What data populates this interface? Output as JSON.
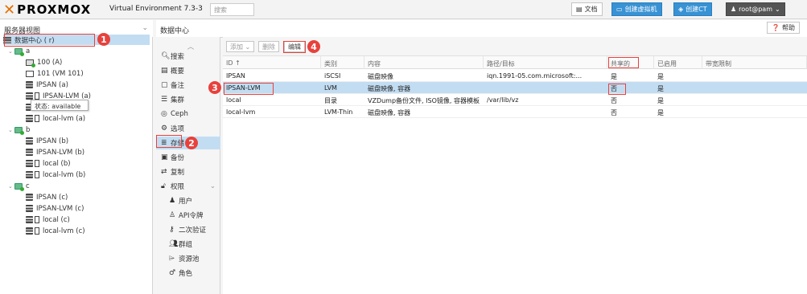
{
  "header": {
    "logo_x": "✕",
    "logo_text": "PROXMOX",
    "subtitle": "Virtual Environment 7.3-3",
    "search_placeholder": "搜索",
    "docs": "文档",
    "create_vm": "创建虚拟机",
    "create_ct": "创建CT",
    "user": "root@pam"
  },
  "left_panel": {
    "header": "服务器视图",
    "root": "数据中心 (               r)",
    "tooltip": "状态: available",
    "nodes": [
      {
        "name": "a",
        "children": [
          "100 (A)",
          "101 (VM 101)",
          "IPSAN (a)",
          "IPSAN-LVM (a)",
          "l",
          "local-lvm (a)"
        ]
      },
      {
        "name": "b",
        "children": [
          "IPSAN (b)",
          "IPSAN-LVM (b)",
          "local (b)",
          "local-lvm (b)"
        ]
      },
      {
        "name": "c",
        "children": [
          "IPSAN (c)",
          "IPSAN-LVM (c)",
          "local (c)",
          "local-lvm (c)"
        ]
      }
    ]
  },
  "content_header": {
    "title": "数据中心",
    "help": "帮助"
  },
  "nav": [
    {
      "label": "搜索",
      "icon": "search-icon"
    },
    {
      "label": "概要",
      "icon": "book-icon"
    },
    {
      "label": "备注",
      "icon": "note-icon"
    },
    {
      "label": "集群",
      "icon": "server-icon"
    },
    {
      "label": "Ceph",
      "icon": "ceph-icon"
    },
    {
      "label": "选项",
      "icon": "gear-icon"
    },
    {
      "label": "存储",
      "icon": "database-icon"
    },
    {
      "label": "备份",
      "icon": "save-icon"
    },
    {
      "label": "复制",
      "icon": "retweet-icon"
    },
    {
      "label": "权限",
      "icon": "unlock-icon"
    },
    {
      "label": "用户",
      "icon": "user-icon"
    },
    {
      "label": "API令牌",
      "icon": "user-outline-icon"
    },
    {
      "label": "二次验证",
      "icon": "key-icon"
    },
    {
      "label": "群组",
      "icon": "users-icon"
    },
    {
      "label": "资源池",
      "icon": "tags-icon"
    },
    {
      "label": "角色",
      "icon": "male-icon"
    }
  ],
  "toolbar": {
    "add": "添加 ⌄",
    "remove": "删除",
    "edit": "编辑"
  },
  "table": {
    "columns": [
      "ID ↑",
      "类别",
      "内容",
      "路径/目标",
      "共享的",
      "已启用",
      "带宽限制"
    ],
    "rows": [
      [
        "IPSAN",
        "iSCSI",
        "磁盘映像",
        "iqn.1991-05.com.microsoft:...",
        "是",
        "是",
        ""
      ],
      [
        "IPSAN-LVM",
        "LVM",
        "磁盘映像, 容器",
        "",
        "否",
        "是",
        ""
      ],
      [
        "local",
        "目录",
        "VZDump备份文件, ISO镜像, 容器模板",
        "/var/lib/vz",
        "否",
        "是",
        ""
      ],
      [
        "local-lvm",
        "LVM-Thin",
        "磁盘映像, 容器",
        "",
        "否",
        "是",
        ""
      ]
    ]
  },
  "callouts": [
    "1",
    "2",
    "3",
    "4"
  ]
}
